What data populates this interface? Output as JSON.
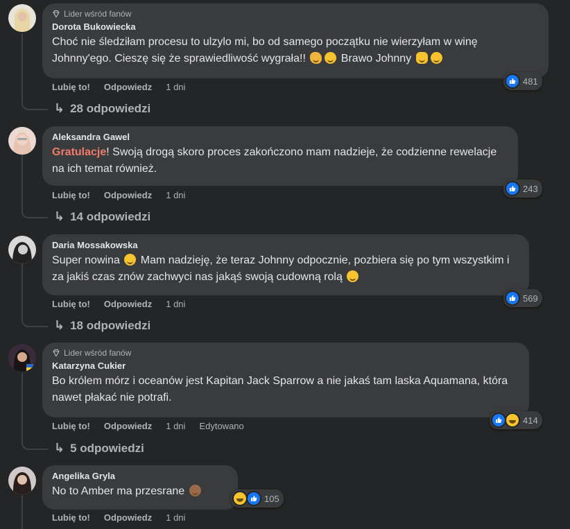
{
  "fan_badge_label": "Lider wśród fanów",
  "comments": [
    {
      "author": "Dorota Bukowiecka",
      "text_before": "Choć nie śledziłam procesu to ulzylo mi, bo od samego początku nie wierzyłam w winę Johnny'ego. Cieszę się że sprawiedliwość wygrała!!",
      "text_after": " Brawo Johnny",
      "like_label": "Lubię to!",
      "reply_label": "Odpowiedz",
      "time": "1 dni",
      "reaction_count": "481",
      "replies_label": "28 odpowiedzi"
    },
    {
      "author": "Aleksandra Gawel",
      "highlight": "Gratulacje",
      "text": "! Swoją drogą skoro proces zakończono mam nadzieje, że codzienne rewelacje na ich temat również.",
      "like_label": "Lubię to!",
      "reply_label": "Odpowiedz",
      "time": "1 dni",
      "reaction_count": "243",
      "replies_label": "14 odpowiedzi"
    },
    {
      "author": "Daria Mossakowska",
      "text_before": "Super nowina",
      "text_after": " Mam nadzieję, że teraz Johnny odpocznie, pozbiera się po tym wszystkim i za jakiś czas znów zachwyci nas jakąś swoją cudowną rolą",
      "like_label": "Lubię to!",
      "reply_label": "Odpowiedz",
      "time": "1 dni",
      "reaction_count": "569",
      "replies_label": "18 odpowiedzi"
    },
    {
      "author": "Katarzyna Cukier",
      "text": "Bo królem mórz i oceanów jest Kapitan Jack Sparrow a nie jakaś tam laska Aquamana, która nawet płakać nie potrafi.",
      "like_label": "Lubię to!",
      "reply_label": "Odpowiedz",
      "time": "1 dni",
      "edited": "Edytowano",
      "reaction_count": "414",
      "replies_label": "5 odpowiedzi"
    },
    {
      "author": "Angelika Gryla",
      "text": "No to Amber ma przesrane",
      "like_label": "Lubię to!",
      "reply_label": "Odpowiedz",
      "time": "1 dni",
      "reaction_count": "105"
    }
  ],
  "colors": {
    "background": "#242526",
    "bubble": "#3a3b3c",
    "like_blue": "#1877f2",
    "highlight": "#f07b6b"
  }
}
